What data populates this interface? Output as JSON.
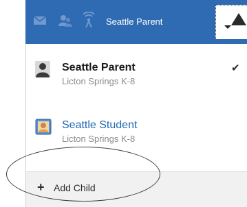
{
  "header": {
    "icons": [
      "mail-icon",
      "people-icon",
      "signal-icon"
    ],
    "user_name": "Seattle Parent",
    "background": "#2f6bb3"
  },
  "menu": {
    "items": [
      {
        "name": "Seattle Parent",
        "school": "Licton Springs K-8",
        "icon": "person-silhouette-icon",
        "selected": true,
        "check": "✔"
      },
      {
        "name": "Seattle Student",
        "school": "Licton Springs K-8",
        "icon": "student-id-icon",
        "selected": false
      }
    ],
    "add_child": {
      "plus": "+",
      "label": "Add Child"
    }
  },
  "colors": {
    "link": "#1f67b8",
    "secondary_text": "#8a8a8a",
    "footer_bg": "#f1f1f1"
  }
}
